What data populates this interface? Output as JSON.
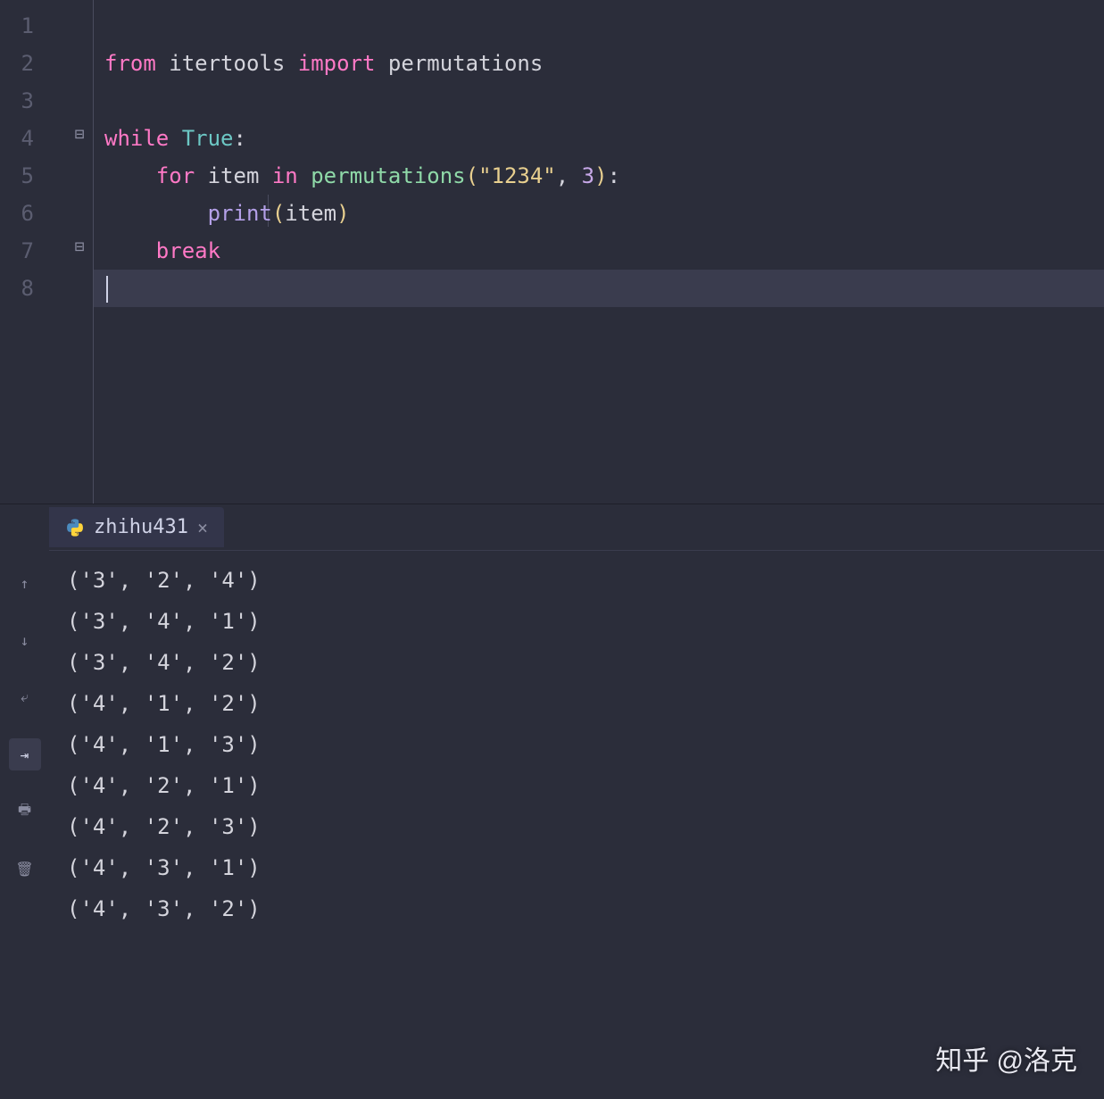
{
  "editor": {
    "line_numbers": [
      "1",
      "2",
      "3",
      "4",
      "5",
      "6",
      "7",
      "8"
    ],
    "code": {
      "l1": "",
      "l2": {
        "from": "from",
        "module": "itertools",
        "import": "import",
        "name": "permutations"
      },
      "l3": "",
      "l4": {
        "while": "while",
        "true": "True",
        "colon": ":"
      },
      "l5": {
        "for": "for",
        "var": "item",
        "in": "in",
        "fn": "permutations",
        "lp": "(",
        "str": "\"1234\"",
        "comma": ",",
        "num": "3",
        "rp": ")",
        "colon": ":"
      },
      "l6": {
        "fn": "print",
        "lp": "(",
        "arg": "item",
        "rp": ")"
      },
      "l7": {
        "break": "break"
      },
      "l8": ""
    },
    "fold_minus_top": "⊟",
    "fold_minus_mid": "⊟"
  },
  "console": {
    "tab_label": "zhihu431",
    "output_lines": [
      "('3', '2', '4')",
      "('3', '4', '1')",
      "('3', '4', '2')",
      "('4', '1', '2')",
      "('4', '1', '3')",
      "('4', '2', '1')",
      "('4', '2', '3')",
      "('4', '3', '1')",
      "('4', '3', '2')"
    ]
  },
  "toolbar_icons": {
    "up": "↑",
    "down": "↓",
    "wrap": "⤶",
    "scroll": "⇥",
    "print": "🖶",
    "trash": "🗑"
  },
  "watermark": "知乎 @洛克"
}
